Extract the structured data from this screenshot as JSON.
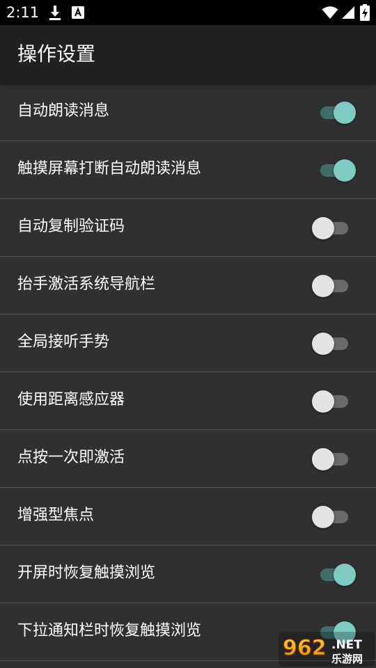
{
  "status_bar": {
    "time": "2:11",
    "icons": [
      "download-icon",
      "font-notification-icon",
      "wifi-icon",
      "signal-icon",
      "battery-charging-icon"
    ]
  },
  "header": {
    "title": "操作设置"
  },
  "settings": [
    {
      "label": "自动朗读消息",
      "enabled": true
    },
    {
      "label": "触摸屏幕打断自动朗读消息",
      "enabled": true
    },
    {
      "label": "自动复制验证码",
      "enabled": false
    },
    {
      "label": "抬手激活系统导航栏",
      "enabled": false
    },
    {
      "label": "全局接听手势",
      "enabled": false
    },
    {
      "label": "使用距离感应器",
      "enabled": false
    },
    {
      "label": "点按一次即激活",
      "enabled": false
    },
    {
      "label": "增强型焦点",
      "enabled": false
    },
    {
      "label": "开屏时恢复触摸浏览",
      "enabled": true
    },
    {
      "label": "下拉通知栏时恢复触摸浏览",
      "enabled": true
    }
  ],
  "watermark": {
    "brand": "962",
    "suffix": ".NET",
    "sub": "乐游网"
  },
  "colors": {
    "background": "#303030",
    "app_bar": "#212121",
    "status_bar": "#000000",
    "divider": "#555555",
    "switch_on_thumb": "#7ecbc3",
    "switch_on_track": "#3f6e6a",
    "switch_off_thumb": "#e3e3e3",
    "switch_off_track": "#6a6a6a"
  }
}
